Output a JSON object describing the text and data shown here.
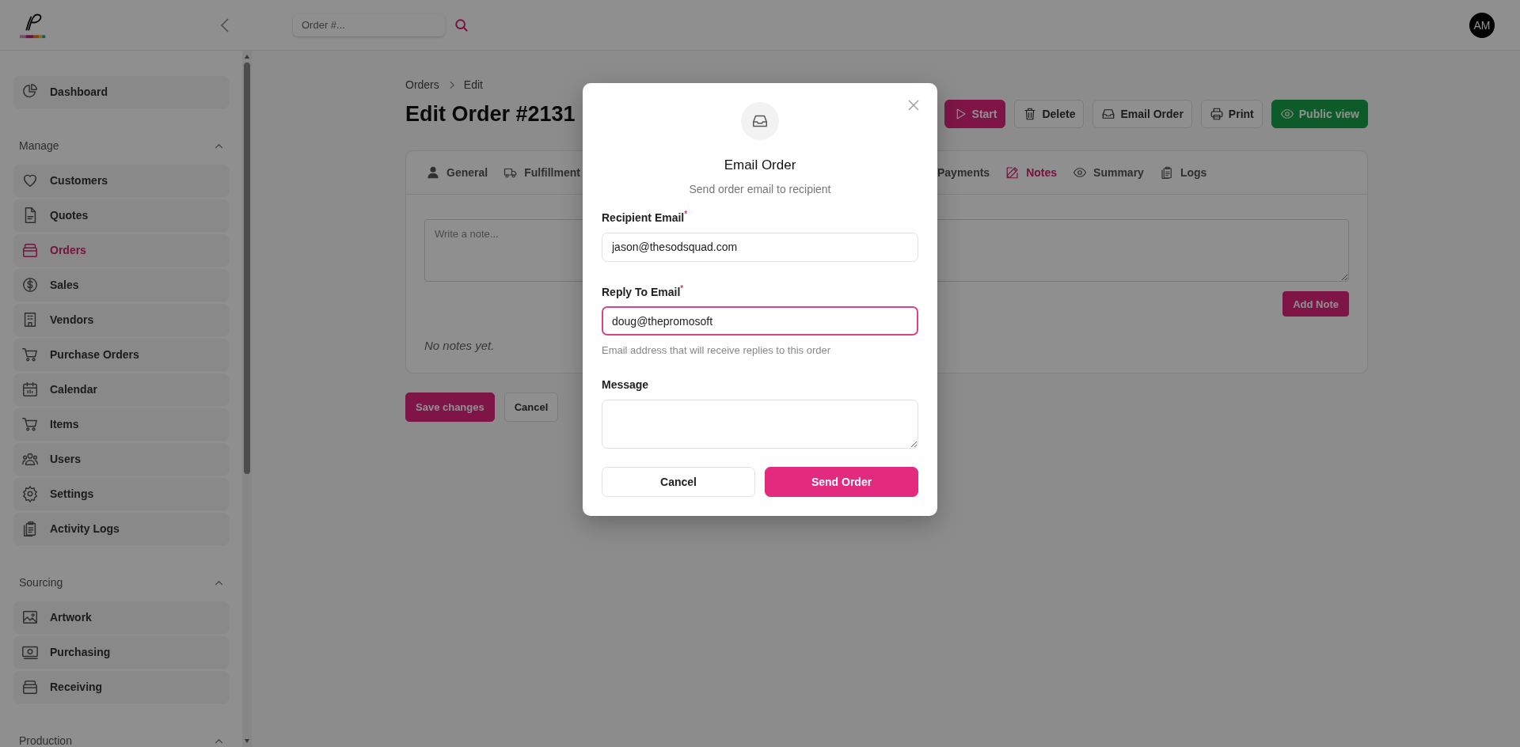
{
  "header": {
    "search": {
      "placeholder": "Order #..."
    },
    "avatar": "AM"
  },
  "sidebar": {
    "items": [
      {
        "label": "Dashboard",
        "selected": false
      }
    ],
    "sections": [
      {
        "title": "Manage",
        "expanded": true,
        "items": [
          {
            "label": "Customers",
            "selected": false
          },
          {
            "label": "Quotes",
            "selected": false
          },
          {
            "label": "Orders",
            "selected": true
          },
          {
            "label": "Sales",
            "selected": false
          },
          {
            "label": "Vendors",
            "selected": false
          },
          {
            "label": "Purchase Orders",
            "selected": false
          },
          {
            "label": "Calendar",
            "selected": false
          },
          {
            "label": "Items",
            "selected": false
          },
          {
            "label": "Users",
            "selected": false
          },
          {
            "label": "Settings",
            "selected": false
          },
          {
            "label": "Activity Logs",
            "selected": false
          }
        ]
      },
      {
        "title": "Sourcing",
        "expanded": true,
        "items": [
          {
            "label": "Artwork",
            "selected": false
          },
          {
            "label": "Purchasing",
            "selected": false
          },
          {
            "label": "Receiving",
            "selected": false
          }
        ]
      },
      {
        "title": "Production",
        "expanded": true
      }
    ]
  },
  "breadcrumb": [
    "Orders",
    "Edit"
  ],
  "page_title": "Edit Order #2131",
  "actions": [
    {
      "label": "Start",
      "kind": "primary"
    },
    {
      "label": "Delete",
      "kind": "default"
    },
    {
      "label": "Email Order",
      "kind": "default"
    },
    {
      "label": "Print",
      "kind": "default"
    },
    {
      "label": "Public view",
      "kind": "success"
    }
  ],
  "tabs": [
    {
      "label": "General",
      "selected": false
    },
    {
      "label": "Fulfillment",
      "selected": false
    },
    {
      "label": "Payments",
      "selected": false
    },
    {
      "label": "Notes",
      "selected": true
    },
    {
      "label": "Summary",
      "selected": false
    },
    {
      "label": "Logs",
      "selected": false
    }
  ],
  "note": {
    "placeholder": "Write a note...",
    "button": "Add Note",
    "empty": "No notes yet."
  },
  "footer_buttons": [
    {
      "label": "Save changes",
      "kind": "primary"
    },
    {
      "label": "Cancel",
      "kind": "default"
    }
  ],
  "modal": {
    "title": "Email Order",
    "subtitle": "Send order email to recipient",
    "fields": [
      {
        "kind": "input",
        "label": "Recipient Email",
        "required_mark": "*",
        "value": "jason@thesodsquad.com",
        "focused": false
      },
      {
        "kind": "input",
        "label": "Reply To Email",
        "required_mark": "*",
        "value": "doug@thepromosoft",
        "focused": true,
        "help": "Email address that will receive replies to this order"
      },
      {
        "kind": "textarea",
        "label": "Message",
        "focused": false
      }
    ],
    "buttons": [
      {
        "label": "Cancel",
        "kind": "default"
      },
      {
        "label": "Send Order",
        "kind": "primary"
      }
    ]
  }
}
